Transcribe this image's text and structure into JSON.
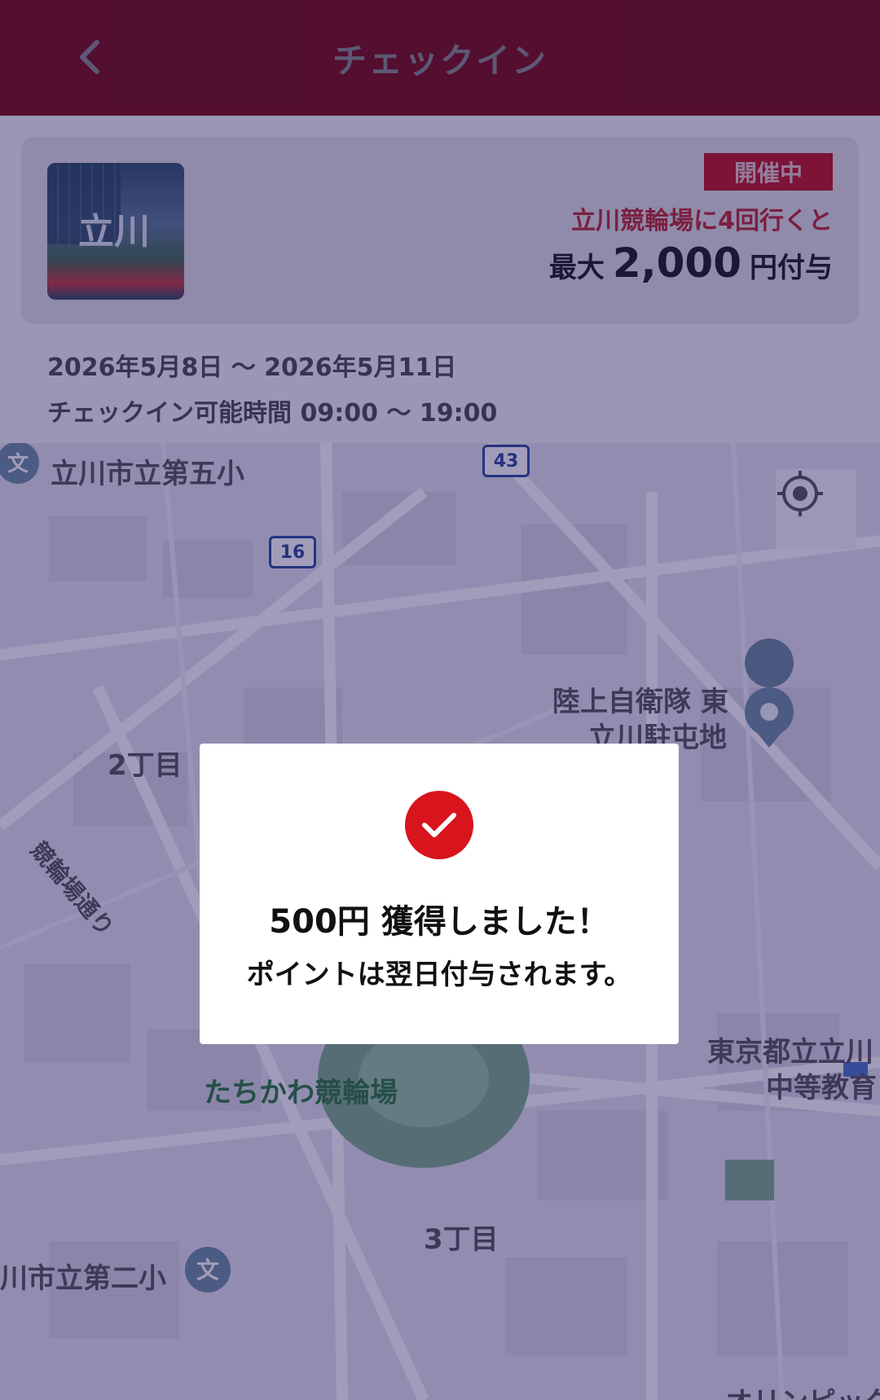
{
  "header": {
    "title": "チェックイン",
    "back_icon": "chevron-left-icon"
  },
  "event": {
    "thumbnail_label": "立川",
    "status_badge": "開催中",
    "promo_line": "立川競輪場に4回行くと",
    "reward_prefix": "最大",
    "reward_amount": "2,000",
    "reward_suffix": "円付与",
    "date_range": "2026年5月8日 〜 2026年5月11日",
    "checkin_hours": "チェックイン可能時間 09:00 〜 19:00"
  },
  "map": {
    "labels": {
      "school_top": "立川市立第五小",
      "route_43": "43",
      "route_16": "16",
      "jsdf": "陸上自衛隊 東",
      "jsdf2": "立川駐屯地",
      "district_2": "2丁目",
      "street": "競輪場通り",
      "tokyo_school": "東京都立立川",
      "tokyo_school2": "中等教育",
      "velodrome": "たちかわ競輪場",
      "district_3": "3丁目",
      "school_bottom": "川市立第二小",
      "olympic": "オリンピック"
    },
    "location_button_icon": "crosshair-icon"
  },
  "modal": {
    "icon": "check-circle-icon",
    "title": "500円 獲得しました！",
    "subtitle": "ポイントは翌日付与されます。"
  },
  "colors": {
    "brand": "#7a0b10",
    "accent": "#d8141c"
  }
}
